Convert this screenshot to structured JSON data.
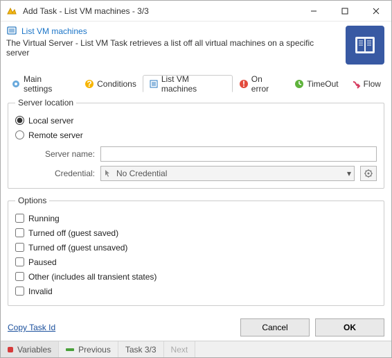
{
  "window": {
    "title": "Add Task - List VM machines - 3/3"
  },
  "header": {
    "title": "List VM machines",
    "description": "The Virtual Server - List VM Task retrieves a list off all virtual machines on a specific server"
  },
  "tabs": [
    {
      "label": "Main settings"
    },
    {
      "label": "Conditions"
    },
    {
      "label": "List VM machines"
    },
    {
      "label": "On error"
    },
    {
      "label": "TimeOut"
    },
    {
      "label": "Flow"
    }
  ],
  "serverLocation": {
    "legend": "Server location",
    "localLabel": "Local server",
    "remoteLabel": "Remote server",
    "serverNameLabel": "Server name:",
    "serverNameValue": "",
    "credentialLabel": "Credential:",
    "credentialValue": "No Credential"
  },
  "options": {
    "legend": "Options",
    "items": [
      "Running",
      "Turned off (guest saved)",
      "Turned off (guest unsaved)",
      "Paused",
      "Other (includes all transient states)",
      "Invalid"
    ]
  },
  "footer": {
    "copyLink": "Copy Task Id",
    "cancel": "Cancel",
    "ok": "OK"
  },
  "status": {
    "variables": "Variables",
    "previous": "Previous",
    "task": "Task 3/3",
    "next": "Next"
  }
}
